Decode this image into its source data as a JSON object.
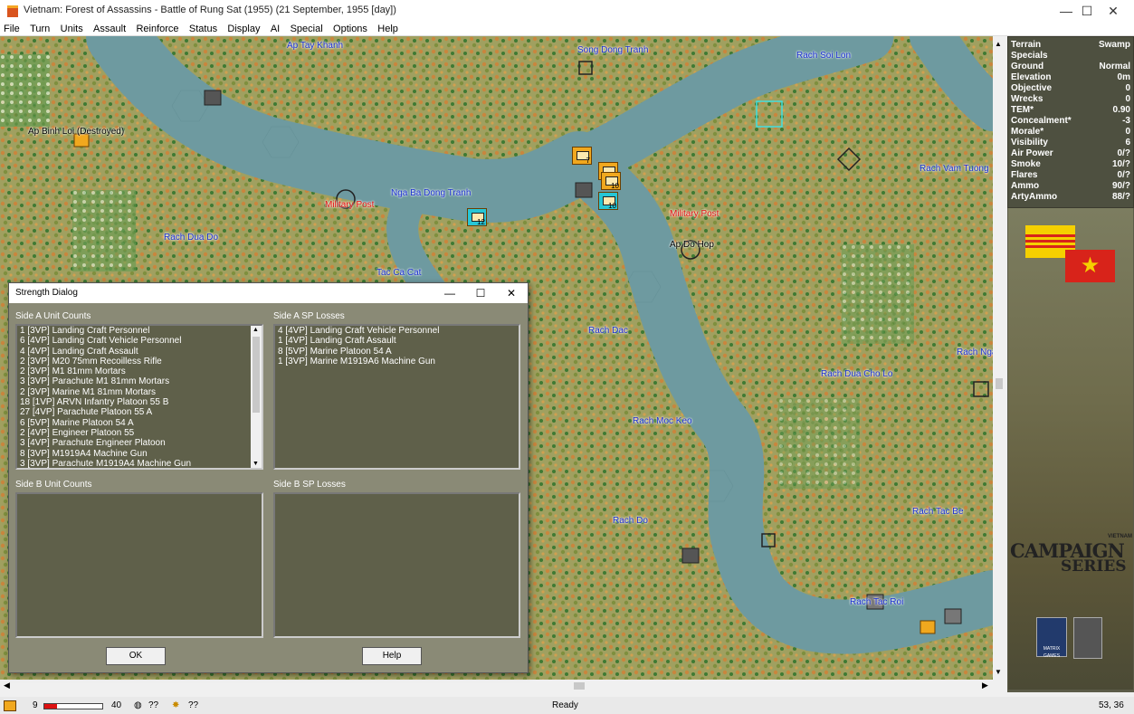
{
  "window": {
    "title": "Vietnam: Forest of Assassins - Battle of Rung Sat (1955) (21 September, 1955 [day])",
    "minimize": "—",
    "maximize": "☐",
    "close": "✕"
  },
  "menu": [
    "File",
    "Turn",
    "Units",
    "Assault",
    "Reinforce",
    "Status",
    "Display",
    "AI",
    "Special",
    "Options",
    "Help"
  ],
  "map": {
    "labels": [
      {
        "text": "Ap Tay Khanh",
        "cls": "black"
      },
      {
        "text": "Song Dong Tranh",
        "cls": ""
      },
      {
        "text": "Rach Soi Lon",
        "cls": ""
      },
      {
        "text": "Ap Binh Loi (Destroyed)",
        "cls": "black"
      },
      {
        "text": "Nga Ba Dong Tranh",
        "cls": ""
      },
      {
        "text": "Military Post",
        "cls": "red"
      },
      {
        "text": "Military Post",
        "cls": "red"
      },
      {
        "text": "Ap Do Hop",
        "cls": "black"
      },
      {
        "text": "Rach Vam Tuong",
        "cls": ""
      },
      {
        "text": "Rach Dua Do",
        "cls": ""
      },
      {
        "text": "Tac Ca Cat",
        "cls": ""
      },
      {
        "text": "Rach Dac",
        "cls": ""
      },
      {
        "text": "Rach Nga",
        "cls": ""
      },
      {
        "text": "Rach Dua Cho Lo",
        "cls": ""
      },
      {
        "text": "Rach Moc Keo",
        "cls": ""
      },
      {
        "text": "Rach Do",
        "cls": ""
      },
      {
        "text": "Rach Tac Be",
        "cls": ""
      },
      {
        "text": "Rach Tac Roi",
        "cls": ""
      }
    ],
    "counters": [
      {
        "n": "7",
        "color": "orange"
      },
      {
        "n": "8",
        "color": "orange"
      },
      {
        "n": "10",
        "color": "orange"
      },
      {
        "n": "10",
        "color": "cyan"
      },
      {
        "n": "12",
        "color": "cyan"
      }
    ]
  },
  "terrain_info": [
    {
      "label": "Terrain",
      "value": "Swamp"
    },
    {
      "label": "Specials",
      "value": ""
    },
    {
      "label": "Ground",
      "value": "Normal"
    },
    {
      "label": "Elevation",
      "value": "0m"
    },
    {
      "label": "Objective",
      "value": "0"
    },
    {
      "label": "Wrecks",
      "value": "0"
    },
    {
      "label": "TEM*",
      "value": "0.90"
    },
    {
      "label": "Concealment*",
      "value": "-3"
    },
    {
      "label": "Morale*",
      "value": "0"
    },
    {
      "label": "Visibility",
      "value": "6"
    },
    {
      "label": "Air Power",
      "value": "0/?"
    },
    {
      "label": "Smoke",
      "value": "10/?"
    },
    {
      "label": "Flares",
      "value": "0/?"
    },
    {
      "label": "Ammo",
      "value": "90/?"
    },
    {
      "label": "ArtyAmmo",
      "value": "88/?"
    }
  ],
  "branding": {
    "line1": "VIETNAM",
    "line2": "CAMPAIGN",
    "line3": "SERIES",
    "publisher": "MATRIX GAMES"
  },
  "dialog": {
    "title": "Strength Dialog",
    "side_a_counts_label": "Side A Unit Counts",
    "side_a_losses_label": "Side A SP Losses",
    "side_b_counts_label": "Side B Unit Counts",
    "side_b_losses_label": "Side B SP Losses",
    "side_a_counts": [
      "1 [3VP] Landing Craft Personnel",
      "6 [4VP] Landing Craft Vehicle Personnel",
      "4 [4VP] Landing Craft Assault",
      "2 [3VP] M20 75mm Recoilless Rifle",
      "2 [3VP] M1 81mm Mortars",
      "3 [3VP] Parachute M1 81mm Mortars",
      "2 [3VP] Marine M1 81mm Mortars",
      "18 [1VP] ARVN Infantry Platoon 55 B",
      "27 [4VP] Parachute Platoon 55 A",
      "6 [5VP] Marine Platoon 54 A",
      "2 [4VP] Engineer Platoon 55",
      "3 [4VP] Parachute Engineer Platoon",
      "8 [3VP] M1919A4 Machine Gun",
      "3 [3VP] Parachute M1919A4 Machine Gun"
    ],
    "side_a_losses": [
      "4 [4VP] Landing Craft Vehicle Personnel",
      "1 [4VP] Landing Craft Assault",
      "8 [5VP] Marine Platoon 54 A",
      "1 [3VP] Marine M1919A6 Machine Gun"
    ],
    "ok": "OK",
    "help": "Help"
  },
  "status": {
    "moves": "9",
    "moves_max": "40",
    "q1": "??",
    "q2": "??",
    "ready": "Ready",
    "coords": "53, 36"
  }
}
